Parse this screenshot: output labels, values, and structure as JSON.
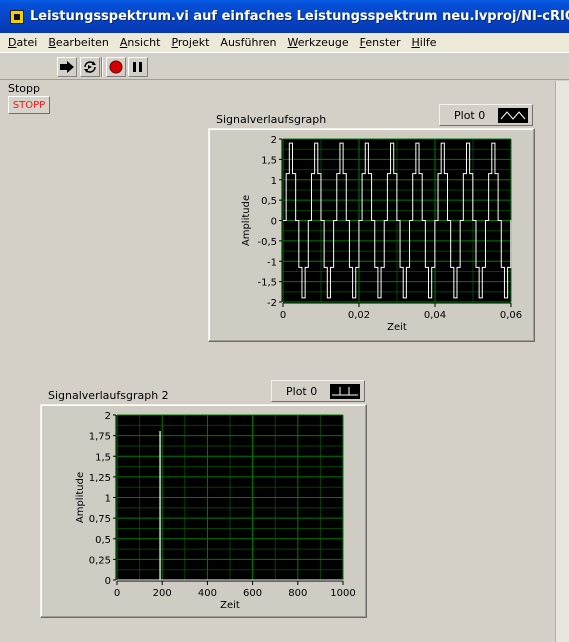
{
  "window": {
    "title": "Leistungsspektrum.vi auf einfaches Leistungsspektrum neu.lvproj/NI-cRIO9022-0154AZ"
  },
  "menu": [
    {
      "label": "Datei",
      "ul": "D",
      "rest": "atei"
    },
    {
      "label": "Bearbeiten",
      "ul": "B",
      "rest": "earbeiten"
    },
    {
      "label": "Ansicht",
      "ul": "A",
      "rest": "nsicht"
    },
    {
      "label": "Projekt",
      "ul": "P",
      "rest": "rojekt"
    },
    {
      "label": "Ausführen",
      "ul": "",
      "rest": "Ausführen"
    },
    {
      "label": "Werkzeuge",
      "ul": "W",
      "rest": "erkzeuge"
    },
    {
      "label": "Fenster",
      "ul": "F",
      "rest": "enster"
    },
    {
      "label": "Hilfe",
      "ul": "H",
      "rest": "ilfe"
    }
  ],
  "stop": {
    "label": "Stopp",
    "button": "STOPP"
  },
  "graph1": {
    "label": "Signalverlaufsgraph",
    "legend": "Plot 0"
  },
  "graph2": {
    "label": "Signalverlaufsgraph 2",
    "legend": "Plot 0"
  },
  "colors": {
    "plot_bg": "#000000",
    "grid": "#007a00",
    "trace": "#ffffff",
    "stop_text": "#ff1010"
  },
  "chart_data": [
    {
      "type": "line",
      "title": "Signalverlaufsgraph",
      "xlabel": "Zeit",
      "ylabel": "Amplitude",
      "xlim": [
        0,
        0.06
      ],
      "ylim": [
        -2,
        2
      ],
      "xticks": [
        "0",
        "0,02",
        "0,04",
        "0,06"
      ],
      "yticks": [
        "2",
        "1,5",
        "1",
        "0,5",
        "0",
        "-0,5",
        "-1",
        "-1,5",
        "-2"
      ],
      "grid": true,
      "series": [
        {
          "name": "Plot 0",
          "description_levels": [
            1.9,
            1.15,
            0,
            -1.15,
            -1.9
          ],
          "period": 0.00666,
          "periods": 9
        }
      ]
    },
    {
      "type": "line",
      "title": "Signalverlaufsgraph 2",
      "xlabel": "Zeit",
      "ylabel": "Amplitude",
      "xlim": [
        0,
        1000
      ],
      "ylim": [
        0,
        2
      ],
      "xticks": [
        "0",
        "200",
        "400",
        "600",
        "800",
        "1000"
      ],
      "yticks": [
        "2",
        "1,75",
        "1,5",
        "1,25",
        "1",
        "0,75",
        "0,5",
        "0,25",
        "0"
      ],
      "grid": true,
      "series": [
        {
          "name": "Plot 0",
          "x": [
            0,
            190,
            190,
            191,
            191,
            1000
          ],
          "y": [
            0,
            0,
            1.8,
            1.8,
            0,
            0
          ]
        }
      ]
    }
  ]
}
